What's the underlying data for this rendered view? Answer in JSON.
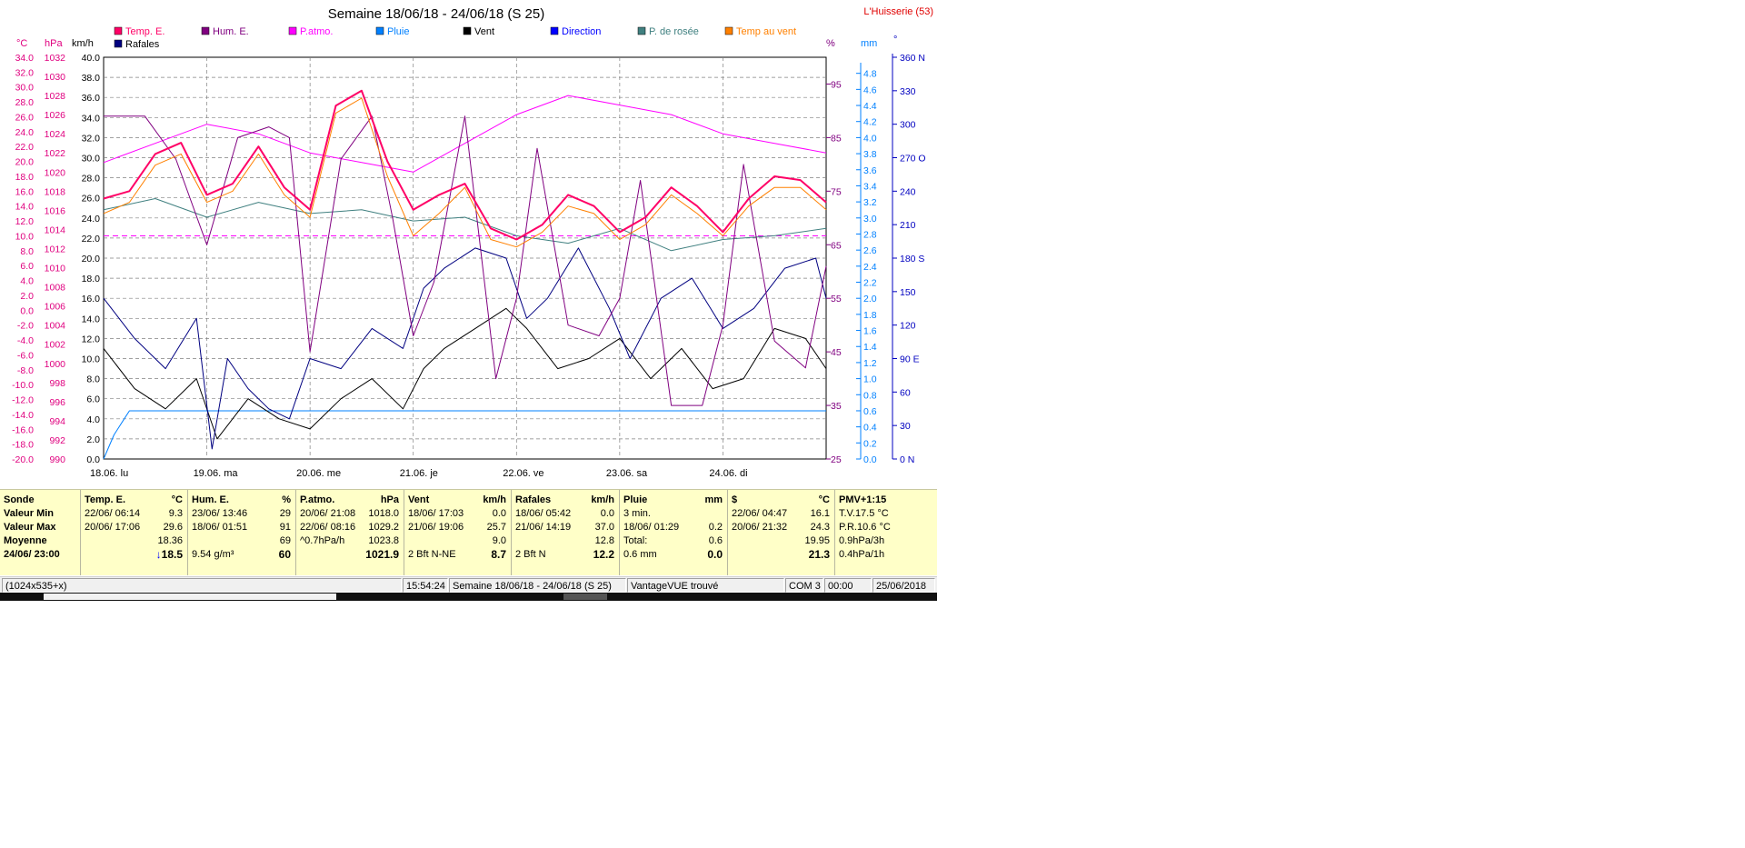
{
  "chart_data": {
    "type": "line",
    "title": "Semaine 18/06/18 - 24/06/18 (S 25)",
    "station": "L'Huisserie (53)",
    "legend": [
      {
        "name": "Temp. E.",
        "color": "#ff0066"
      },
      {
        "name": "Hum. E.",
        "color": "#800080"
      },
      {
        "name": "P.atmo.",
        "color": "#ff00ff"
      },
      {
        "name": "Pluie",
        "color": "#0080ff"
      },
      {
        "name": "Vent",
        "color": "#000000"
      },
      {
        "name": "Direction",
        "color": "#0000ff"
      },
      {
        "name": "P. de rosée",
        "color": "#408080"
      },
      {
        "name": "Temp au vent",
        "color": "#ff8000"
      },
      {
        "name": "Rafales",
        "color": "#000080"
      }
    ],
    "axis_units": {
      "temp": "°C",
      "pressure": "hPa",
      "wind": "km/h",
      "humidity": "%",
      "rain": "mm",
      "direction": "°"
    },
    "x_labels": [
      "18.06.  lu",
      "19.06.  ma",
      "20.06.  me",
      "21.06.  je",
      "22.06.  ve",
      "23.06.  sa",
      "24.06.  di"
    ],
    "x_range_days": [
      0,
      7
    ],
    "temp_axis": {
      "range": [
        -20,
        34
      ],
      "ticks": [
        "34.0",
        "32.0",
        "30.0",
        "28.0",
        "26.0",
        "24.0",
        "22.0",
        "20.0",
        "18.0",
        "16.0",
        "14.0",
        "12.0",
        "10.0",
        "8.0",
        "6.0",
        "4.0",
        "2.0",
        "0.0",
        "-2.0",
        "-4.0",
        "-6.0",
        "-8.0",
        "-10.0",
        "-12.0",
        "-14.0",
        "-16.0",
        "-18.0",
        "-20.0"
      ]
    },
    "pressure_axis": {
      "range": [
        990,
        1032
      ],
      "ticks": [
        "1032",
        "1030",
        "1028",
        "1026",
        "1024",
        "1022",
        "1020",
        "1018",
        "1016",
        "1014",
        "1012",
        "1010",
        "1008",
        "1006",
        "1004",
        "1002",
        "1000",
        "998",
        "996",
        "994",
        "992",
        "990"
      ]
    },
    "wind_axis": {
      "range": [
        0,
        40
      ],
      "ticks": [
        "40.0",
        "38.0",
        "36.0",
        "34.0",
        "32.0",
        "30.0",
        "28.0",
        "26.0",
        "24.0",
        "22.0",
        "20.0",
        "18.0",
        "16.0",
        "14.0",
        "12.0",
        "10.0",
        "8.0",
        "6.0",
        "4.0",
        "2.0",
        "0.0"
      ]
    },
    "humidity_axis": {
      "range": [
        25,
        100
      ],
      "ticks": [
        "95",
        "85",
        "75",
        "65",
        "55",
        "45",
        "35",
        "25"
      ]
    },
    "rain_axis": {
      "range": [
        0,
        5
      ],
      "ticks": [
        "4.8",
        "4.6",
        "4.4",
        "4.2",
        "4.0",
        "3.8",
        "3.6",
        "3.4",
        "3.2",
        "3.0",
        "2.8",
        "2.6",
        "2.4",
        "2.2",
        "2.0",
        "1.8",
        "1.6",
        "1.4",
        "1.2",
        "1.0",
        "0.8",
        "0.6",
        "0.4",
        "0.2",
        "0.0"
      ]
    },
    "direction_axis": {
      "range": [
        0,
        360
      ],
      "ticks": [
        "360 N",
        "330",
        "300",
        "270 O",
        "240",
        "210",
        "180 S",
        "150",
        "120",
        "90  E",
        "60",
        "30",
        "0    N"
      ]
    },
    "series": [
      {
        "name": "Temp. E.",
        "axis": "temp",
        "color": "#ff0066",
        "width": 2,
        "x": [
          0,
          0.25,
          0.5,
          0.75,
          1,
          1.25,
          1.5,
          1.75,
          2,
          2.25,
          2.5,
          2.75,
          3,
          3.25,
          3.5,
          3.75,
          4,
          4.25,
          4.5,
          4.75,
          5,
          5.25,
          5.5,
          5.75,
          6,
          6.25,
          6.5,
          6.75,
          7
        ],
        "y": [
          15,
          16,
          21,
          22.5,
          15.5,
          17,
          22,
          16.5,
          13.5,
          27.5,
          29.5,
          20,
          13.5,
          15.5,
          17,
          11,
          9.5,
          11.5,
          15.5,
          14,
          10.5,
          12.5,
          16.5,
          14,
          10.5,
          15,
          18,
          17.5,
          14.5
        ]
      },
      {
        "name": "Temp au vent",
        "axis": "temp",
        "color": "#ff8000",
        "width": 1,
        "x": [
          0,
          0.25,
          0.5,
          0.75,
          1,
          1.25,
          1.5,
          1.75,
          2,
          2.25,
          2.5,
          2.75,
          3,
          3.25,
          3.5,
          3.75,
          4,
          4.25,
          4.5,
          4.75,
          5,
          5.25,
          5.5,
          5.75,
          6,
          6.25,
          6.5,
          6.75,
          7
        ],
        "y": [
          13,
          14.5,
          19.5,
          21,
          14.5,
          16,
          21,
          15.5,
          12.5,
          26.5,
          28.5,
          18,
          10,
          13,
          16.5,
          9.5,
          8.5,
          10.5,
          14,
          13,
          9.5,
          11.5,
          15.5,
          13,
          10,
          14,
          16.5,
          16.5,
          13.5
        ]
      },
      {
        "name": "P. de rosée",
        "axis": "temp",
        "color": "#408080",
        "width": 1,
        "x": [
          0,
          0.5,
          1,
          1.5,
          2,
          2.5,
          3,
          3.5,
          4,
          4.5,
          5,
          5.5,
          6,
          6.5,
          7
        ],
        "y": [
          13.5,
          15,
          12.5,
          14.5,
          13,
          13.5,
          12,
          12.5,
          10,
          9,
          11,
          8,
          9.5,
          10,
          11
        ]
      },
      {
        "name": "P.atmo.",
        "axis": "pressure",
        "color": "#ff00ff",
        "width": 1,
        "x": [
          0,
          0.5,
          1,
          1.5,
          2,
          2.5,
          3,
          3.5,
          4,
          4.5,
          5,
          5.5,
          6,
          6.5,
          7
        ],
        "y": [
          1021,
          1023,
          1025,
          1024,
          1022,
          1021,
          1020,
          1023,
          1026,
          1028,
          1027,
          1026,
          1024,
          1023,
          1022
        ]
      },
      {
        "name": "Hum. E.",
        "axis": "humidity",
        "color": "#800080",
        "width": 1,
        "x": [
          0,
          0.4,
          0.7,
          1,
          1.3,
          1.6,
          1.8,
          2,
          2.3,
          2.6,
          2.8,
          3,
          3.2,
          3.5,
          3.8,
          4,
          4.2,
          4.5,
          4.8,
          5,
          5.2,
          5.5,
          5.8,
          6,
          6.2,
          6.5,
          6.8,
          7
        ],
        "y": [
          89,
          89,
          81,
          65,
          85,
          87,
          85,
          45,
          81,
          89,
          70,
          48,
          58,
          89,
          40,
          55,
          83,
          50,
          48,
          55,
          77,
          35,
          35,
          50,
          80,
          47,
          42,
          61
        ]
      },
      {
        "name": "Vent",
        "axis": "wind",
        "color": "#000000",
        "width": 1,
        "x": [
          0,
          0.3,
          0.6,
          0.9,
          1.1,
          1.4,
          1.7,
          2,
          2.3,
          2.6,
          2.9,
          3.1,
          3.3,
          3.6,
          3.9,
          4.1,
          4.4,
          4.7,
          5,
          5.3,
          5.6,
          5.9,
          6.2,
          6.5,
          6.8,
          7
        ],
        "y": [
          11,
          7,
          5,
          8,
          2,
          6,
          4,
          3,
          6,
          8,
          5,
          9,
          11,
          13,
          15,
          13,
          9,
          10,
          12,
          8,
          11,
          7,
          8,
          13,
          12,
          9
        ]
      },
      {
        "name": "Rafales",
        "axis": "wind",
        "color": "#000080",
        "width": 1,
        "x": [
          0,
          0.3,
          0.6,
          0.9,
          1.05,
          1.2,
          1.4,
          1.6,
          1.8,
          2,
          2.3,
          2.6,
          2.9,
          3.1,
          3.3,
          3.6,
          3.9,
          4.1,
          4.3,
          4.6,
          4.9,
          5.1,
          5.4,
          5.7,
          6,
          6.3,
          6.6,
          6.9,
          7
        ],
        "y": [
          16,
          12,
          9,
          14,
          1,
          10,
          7,
          5,
          4,
          10,
          9,
          13,
          11,
          17,
          19,
          21,
          20,
          14,
          16,
          21,
          15,
          10,
          16,
          18,
          13,
          15,
          19,
          20,
          16
        ]
      },
      {
        "name": "Pluie",
        "axis": "rain",
        "color": "#0080ff",
        "width": 1,
        "x": [
          0,
          0.1,
          0.2,
          0.25,
          7
        ],
        "y": [
          0,
          0.3,
          0.5,
          0.6,
          0.6
        ]
      }
    ]
  },
  "summary": {
    "sonde": {
      "header": "Sonde",
      "row1": "Valeur Min",
      "row2": "Valeur Max",
      "row3": "Moyenne",
      "row4": "24/06/ 23:00"
    },
    "temp": {
      "header": "Temp. E.",
      "unit": "°C",
      "min_date": "22/06/  06:14",
      "min_val": "9.3",
      "max_date": "20/06/  17:06",
      "max_val": "29.6",
      "avg": "18.36",
      "cur_arrow": "↓",
      "cur": "18.5"
    },
    "hum": {
      "header": "Hum. E.",
      "unit": "%",
      "min_date": "23/06/  13:46",
      "min_val": "29",
      "max_date": "18/06/  01:51",
      "max_val": "91",
      "avg": "69",
      "cur_sub": "9.54 g/m³",
      "cur": "60"
    },
    "press": {
      "header": "P.atmo.",
      "unit": "hPa",
      "min_date": "20/06/  21:08",
      "min_val": "1018.0",
      "max_date": "22/06/  08:16",
      "max_val": "1029.2",
      "trend": "^0.7hPa/h",
      "avg": "1023.8",
      "cur": "1021.9"
    },
    "vent": {
      "header": "Vent",
      "unit": "km/h",
      "min_date": "18/06/  17:03",
      "min_val": "0.0",
      "max_date": "21/06/  19:06",
      "max_val": "25.7",
      "avg": "9.0",
      "cur_sub": "2 Bft  N-NE",
      "cur": "8.7"
    },
    "rafales": {
      "header": "Rafales",
      "unit": "km/h",
      "min_date": "18/06/  05:42",
      "min_val": "0.0",
      "max_date": "21/06/  14:19",
      "max_val": "37.0",
      "avg": "12.8",
      "cur_sub": "2 Bft  N",
      "cur": "12.2"
    },
    "pluie": {
      "header": "Pluie",
      "unit": "mm",
      "row1": "3 min.",
      "max_date": "18/06/  01:29",
      "max_val": "0.2",
      "total_label": "Total:",
      "total": "0.6",
      "cur_sub": "0.6 mm",
      "cur": "0.0"
    },
    "s": {
      "header": "$",
      "unit": "°C",
      "min_date": "22/06/  04:47",
      "min_val": "16.1",
      "max_date": "20/06/  21:32",
      "max_val": "24.3",
      "avg": "19.95",
      "cur": "21.3"
    },
    "pmv": {
      "header": "PMV+1:15",
      "row1": "T.V.17.5 °C",
      "row2": "P.R.10.6 °C",
      "row3": "0.9hPa/3h",
      "row4": "0.4hPa/1h"
    }
  },
  "statusbar": {
    "size": "(1024x535+x)",
    "time": "15:54:24",
    "period": "Semaine 18/06/18 - 24/06/18 (S 25)",
    "station": "VantageVUE trouvé",
    "port": "COM 3",
    "clock": "00:00",
    "date": "25/06/2018"
  },
  "colors": {
    "panel_bg": "#ffffc8",
    "grid": "#808080",
    "temp_axis": "#e0007f",
    "hum_axis": "#800080",
    "dir_axis": "#0000c0",
    "rain_axis": "#0080ff"
  }
}
